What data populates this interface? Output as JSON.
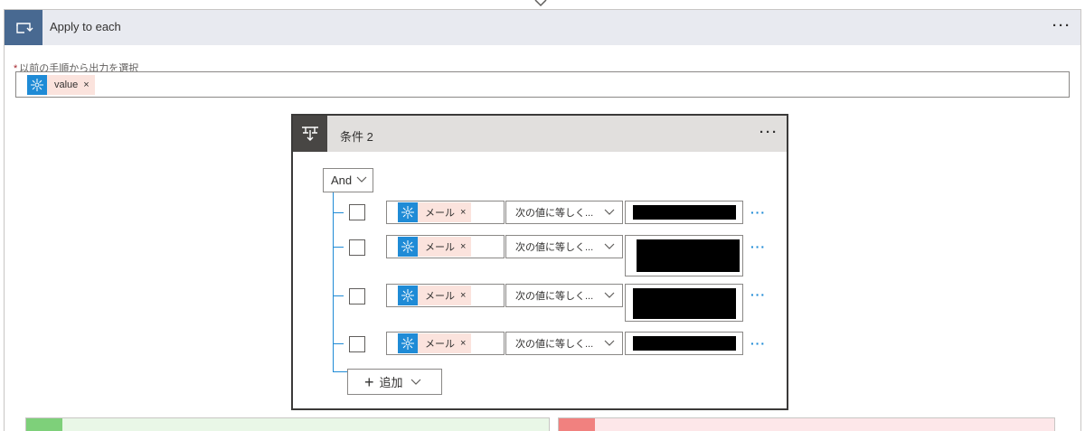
{
  "loop": {
    "title": "Apply to each",
    "icon": "loop-icon",
    "more": "···",
    "field_label": "以前の手順から出力を選択",
    "required_mark": "*",
    "token": {
      "label": "value",
      "close": "×",
      "icon": "dataverse-icon"
    }
  },
  "condition": {
    "title": "条件 2",
    "icon": "condition-icon",
    "more": "···",
    "group_operator": "And",
    "rows": [
      {
        "lhs_token": "メール",
        "close": "×",
        "operator": "次の値に等しく...",
        "more": "···"
      },
      {
        "lhs_token": "メール",
        "close": "×",
        "operator": "次の値に等しく...",
        "more": "···"
      },
      {
        "lhs_token": "メール",
        "close": "×",
        "operator": "次の値に等しく...",
        "more": "···"
      },
      {
        "lhs_token": "メール",
        "close": "×",
        "operator": "次の値に等しく...",
        "more": "···"
      }
    ],
    "add_label": "追加",
    "add_icon": "plus-icon"
  },
  "colors": {
    "loop_icon_bg": "#486991",
    "condition_icon_bg": "#484644",
    "token_bg": "#fbe3dd",
    "token_icon_bg": "#1f8bd6",
    "yes_branch": "#7ed07a",
    "no_branch": "#f1817f"
  }
}
